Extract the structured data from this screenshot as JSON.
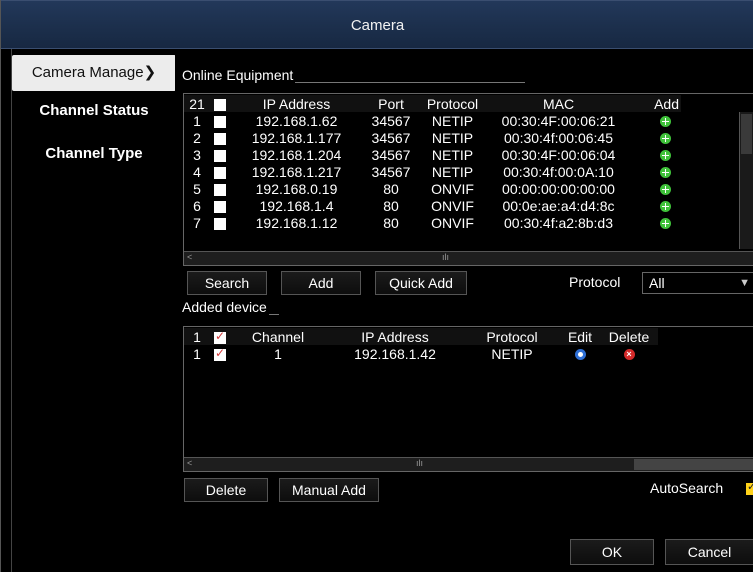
{
  "window": {
    "title": "Camera"
  },
  "sidebar": {
    "items": [
      {
        "label": "Camera Manage",
        "arrow": "❯",
        "active": true
      },
      {
        "label": "Channel Status"
      },
      {
        "label": "Channel Type"
      }
    ]
  },
  "online": {
    "section_title": "Online Equipment",
    "headers": {
      "count": "21",
      "ip": "IP Address",
      "port": "Port",
      "protocol": "Protocol",
      "mac": "MAC",
      "add": "Add"
    },
    "rows": [
      {
        "no": "1",
        "ip": "192.168.1.62",
        "port": "34567",
        "protocol": "NETIP",
        "mac": "00:30:4F:00:06:21"
      },
      {
        "no": "2",
        "ip": "192.168.1.177",
        "port": "34567",
        "protocol": "NETIP",
        "mac": "00:30:4f:00:06:45"
      },
      {
        "no": "3",
        "ip": "192.168.1.204",
        "port": "34567",
        "protocol": "NETIP",
        "mac": "00:30:4F:00:06:04"
      },
      {
        "no": "4",
        "ip": "192.168.1.217",
        "port": "34567",
        "protocol": "NETIP",
        "mac": "00:30:4f:00:0A:10"
      },
      {
        "no": "5",
        "ip": "192.168.0.19",
        "port": "80",
        "protocol": "ONVIF",
        "mac": "00:00:00:00:00:00"
      },
      {
        "no": "6",
        "ip": "192.168.1.4",
        "port": "80",
        "protocol": "ONVIF",
        "mac": "00:0e:ae:a4:d4:8c"
      },
      {
        "no": "7",
        "ip": "192.168.1.12",
        "port": "80",
        "protocol": "ONVIF",
        "mac": "00:30:4f:a2:8b:d3"
      }
    ]
  },
  "online_buttons": {
    "search": "Search",
    "add": "Add",
    "quick_add": "Quick Add"
  },
  "protocol_filter": {
    "label": "Protocol",
    "value": "All"
  },
  "added": {
    "section_title": "Added device",
    "headers": {
      "count": "1",
      "channel": "Channel",
      "ip": "IP Address",
      "protocol": "Protocol",
      "edit": "Edit",
      "delete": "Delete"
    },
    "rows": [
      {
        "no": "1",
        "channel": "1",
        "ip": "192.168.1.42",
        "protocol": "NETIP"
      }
    ]
  },
  "added_buttons": {
    "delete": "Delete",
    "manual_add": "Manual Add"
  },
  "autosearch": {
    "label": "AutoSearch",
    "checked": true
  },
  "footer": {
    "ok": "OK",
    "cancel": "Cancel"
  }
}
